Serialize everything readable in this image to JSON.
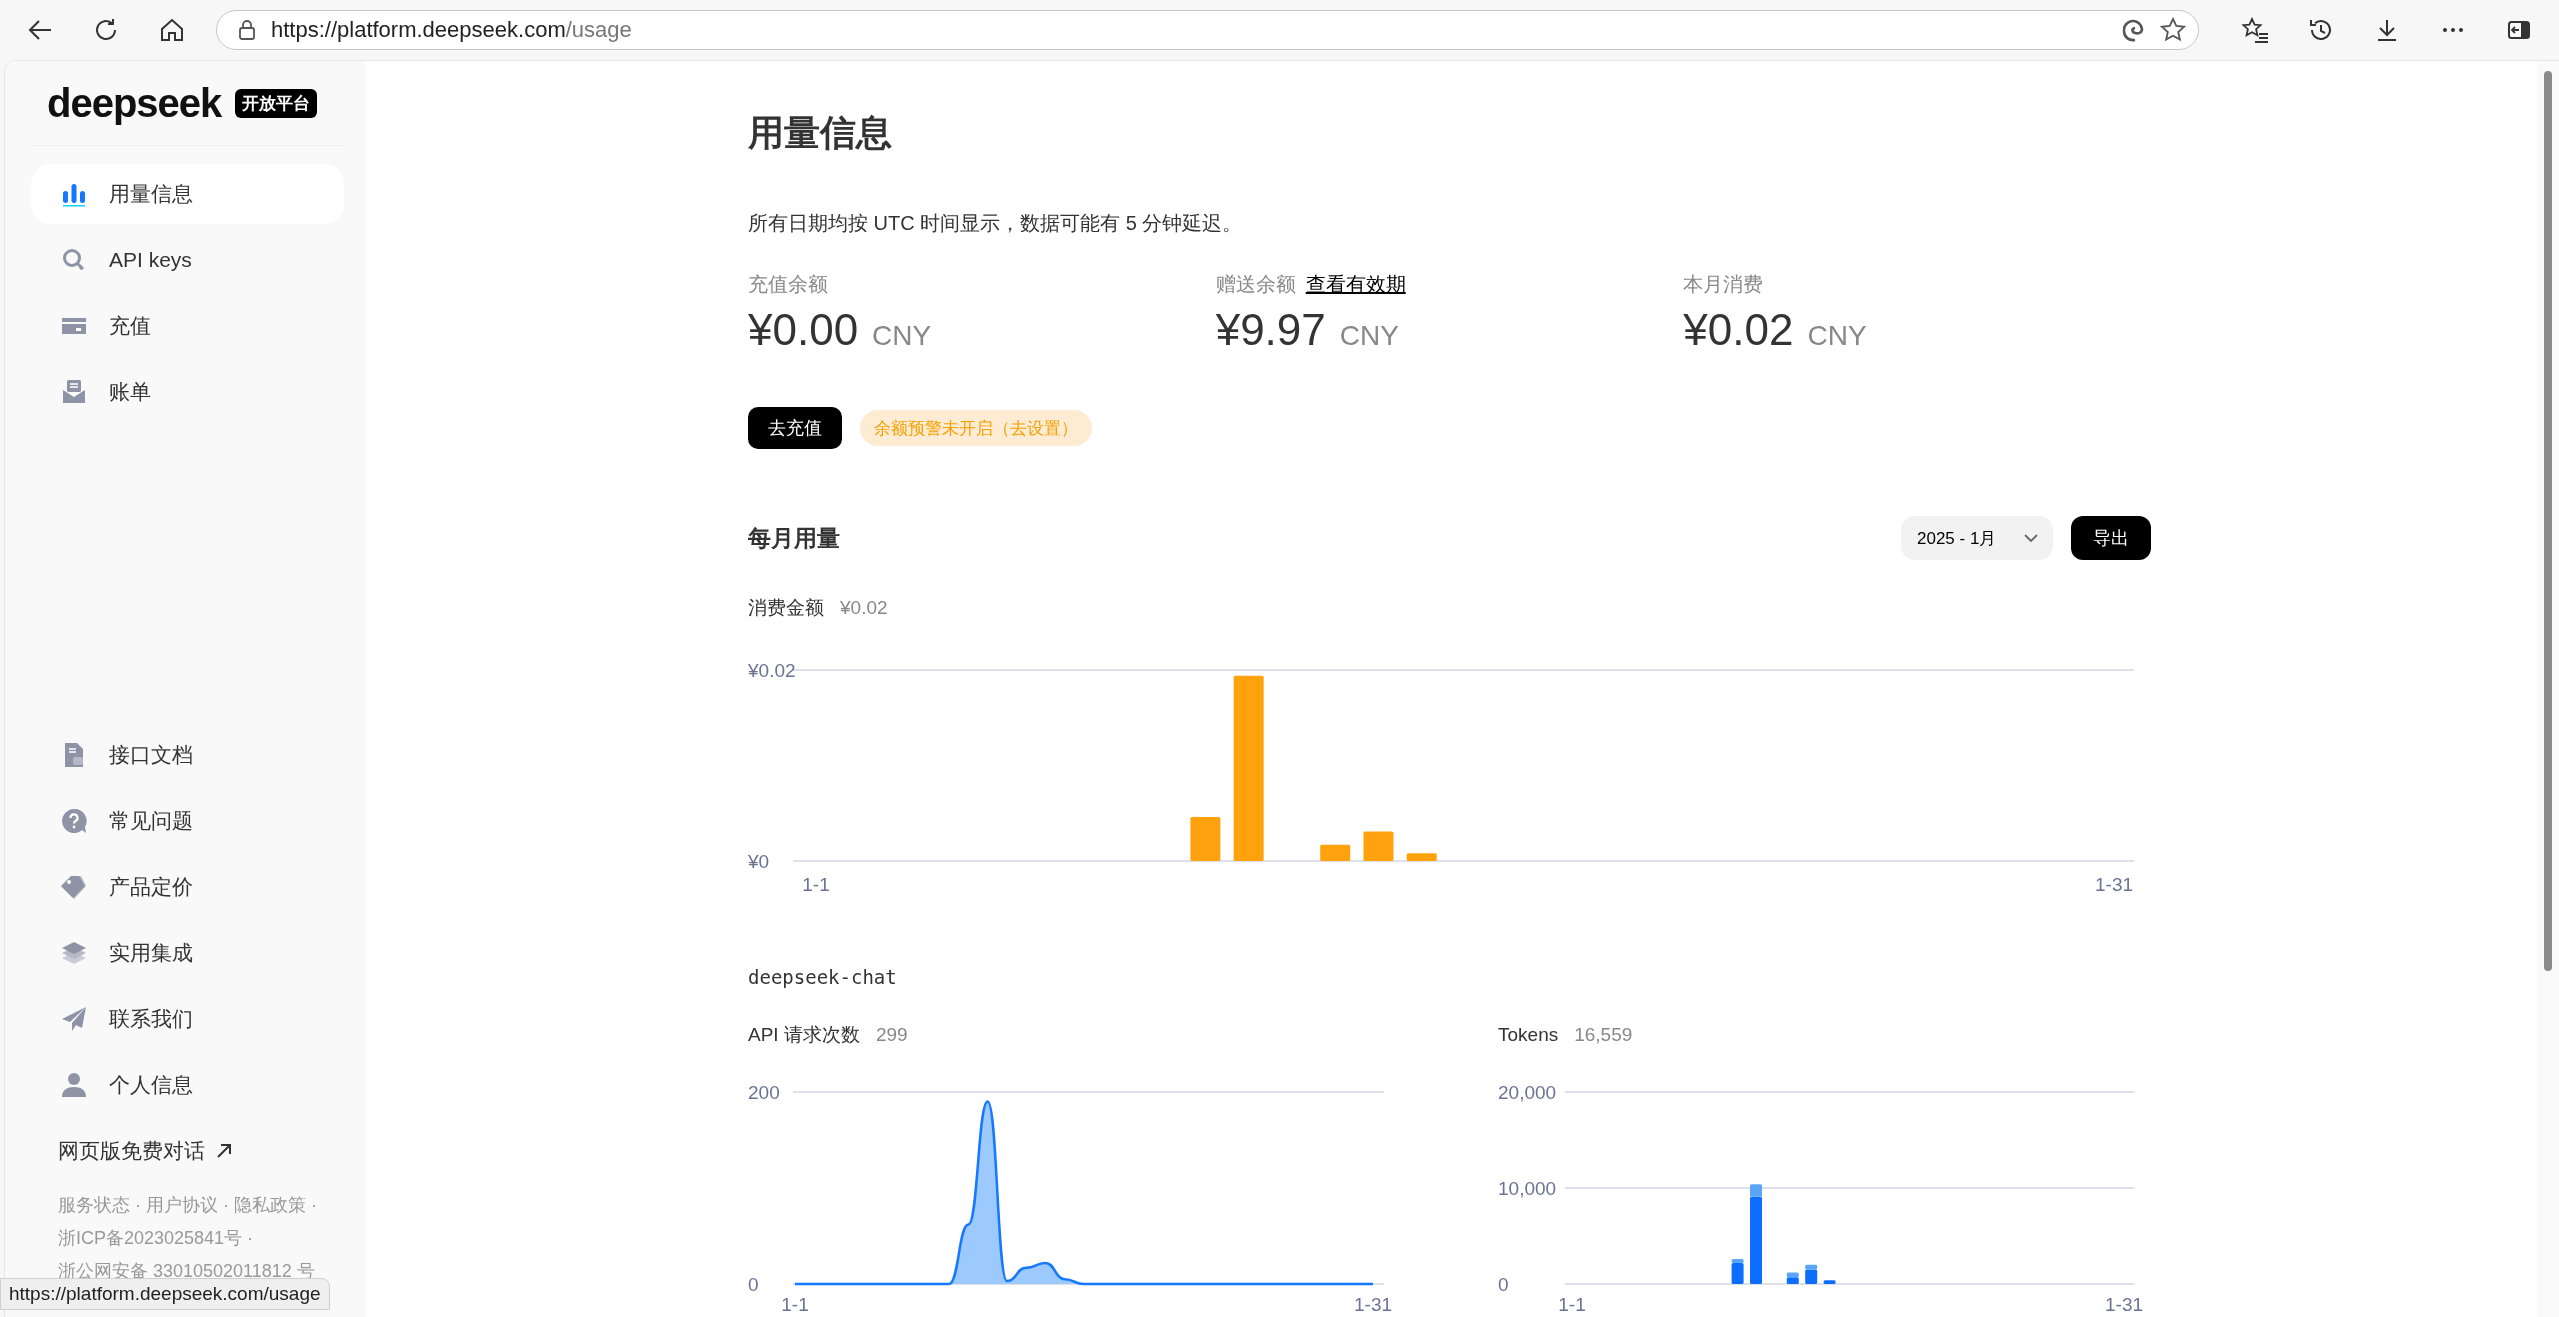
{
  "browser": {
    "url_host": "https://platform.deepseek.com",
    "url_path": "/usage",
    "status_url": "https://platform.deepseek.com/usage"
  },
  "sidebar": {
    "logo": "deepseek",
    "badge": "开放平台",
    "items": [
      {
        "label": "用量信息",
        "selected": true
      },
      {
        "label": "API keys",
        "selected": false
      },
      {
        "label": "充值",
        "selected": false
      },
      {
        "label": "账单",
        "selected": false
      }
    ],
    "lower_items": [
      {
        "label": "接口文档",
        "selected": false
      },
      {
        "label": "常见问题",
        "selected": false
      },
      {
        "label": "产品定价",
        "selected": false
      },
      {
        "label": "实用集成",
        "selected": false
      },
      {
        "label": "联系我们",
        "selected": false
      },
      {
        "label": "个人信息",
        "selected": false
      }
    ],
    "external_link": "网页版免费对话",
    "footer_lines": [
      "服务状态 · 用户协议 · 隐私政策 ·",
      "浙ICP备2023025841号 ·",
      "浙公网安备 33010502011812 号"
    ]
  },
  "page": {
    "title": "用量信息",
    "notice": "所有日期均按 UTC 时间显示，数据可能有 5 分钟延迟。",
    "balances": [
      {
        "label": "充值余额",
        "amount": "¥0.00",
        "currency": "CNY"
      },
      {
        "label": "赠送余额",
        "link": "查看有效期",
        "amount": "¥9.97",
        "currency": "CNY"
      },
      {
        "label": "本月消费",
        "amount": "¥0.02",
        "currency": "CNY"
      }
    ],
    "topup_button": "去充值",
    "alert_badge": "余额预警未开启（去设置）",
    "monthly": {
      "title": "每月用量",
      "month_select": "2025 - 1月",
      "export_button": "导出",
      "cost": {
        "label": "消费金额",
        "total": "¥0.02",
        "chart_data": {
          "type": "bar",
          "categories": [
            "1-1",
            null,
            null,
            null,
            null,
            null,
            null,
            null,
            null,
            null,
            null,
            null,
            null,
            null,
            null,
            null,
            null,
            null,
            null,
            null,
            null,
            null,
            null,
            null,
            null,
            null,
            null,
            null,
            null,
            null,
            "1-31"
          ],
          "yticks": [
            {
              "value": 0,
              "label": "¥0"
            },
            {
              "value": 0.02,
              "label": "¥0.02"
            }
          ],
          "ylim": [
            0,
            0.02
          ],
          "series": [
            {
              "color": "#ffa20d",
              "values": [
                0,
                0,
                0,
                0,
                0,
                0,
                0,
                0,
                0,
                0.0046,
                0.0194,
                0,
                0.0017,
                0.0031,
                0.0008,
                0,
                0,
                0,
                0,
                0,
                0,
                0,
                0,
                0,
                0,
                0,
                0,
                0,
                0,
                0,
                0
              ]
            }
          ]
        }
      },
      "model": "deepseek-chat",
      "requests": {
        "label": "API 请求次数",
        "total": "299",
        "chart_data": {
          "type": "area",
          "categories": [
            "1-1",
            null,
            null,
            null,
            null,
            null,
            null,
            null,
            null,
            null,
            null,
            null,
            null,
            null,
            null,
            null,
            null,
            null,
            null,
            null,
            null,
            null,
            null,
            null,
            null,
            null,
            null,
            null,
            null,
            null,
            "1-31"
          ],
          "yticks": [
            0,
            200
          ],
          "ylim": [
            0,
            200
          ],
          "series": [
            {
              "color": "#1677ff",
              "values": [
                0,
                0,
                0,
                0,
                0,
                0,
                0,
                0,
                0,
                62,
                190,
                3,
                17,
                22,
                5,
                0,
                0,
                0,
                0,
                0,
                0,
                0,
                0,
                0,
                0,
                0,
                0,
                0,
                0,
                0,
                0
              ]
            }
          ]
        }
      },
      "tokens": {
        "label": "Tokens",
        "total": "16,559",
        "chart_data": {
          "type": "bar",
          "stacked": true,
          "categories": [
            "1-1",
            null,
            null,
            null,
            null,
            null,
            null,
            null,
            null,
            null,
            null,
            null,
            null,
            null,
            null,
            null,
            null,
            null,
            null,
            null,
            null,
            null,
            null,
            null,
            null,
            null,
            null,
            null,
            null,
            null,
            "1-31"
          ],
          "yticks": [
            {
              "value": 0,
              "label": "0"
            },
            {
              "value": 10000,
              "label": "10,000"
            },
            {
              "value": 20000,
              "label": "20,000"
            }
          ],
          "ylim": [
            0,
            20000
          ],
          "series": [
            {
              "color": "#0d6efd",
              "values": [
                0,
                0,
                0,
                0,
                0,
                0,
                0,
                0,
                0,
                2200,
                9100,
                0,
                700,
                1500,
                400,
                0,
                0,
                0,
                0,
                0,
                0,
                0,
                0,
                0,
                0,
                0,
                0,
                0,
                0,
                0,
                0
              ]
            },
            {
              "color": "#5aa5f5",
              "values": [
                0,
                0,
                0,
                0,
                0,
                0,
                0,
                0,
                0,
                400,
                1300,
                0,
                500,
                500,
                0,
                0,
                0,
                0,
                0,
                0,
                0,
                0,
                0,
                0,
                0,
                0,
                0,
                0,
                0,
                0,
                0
              ]
            }
          ]
        }
      }
    }
  }
}
